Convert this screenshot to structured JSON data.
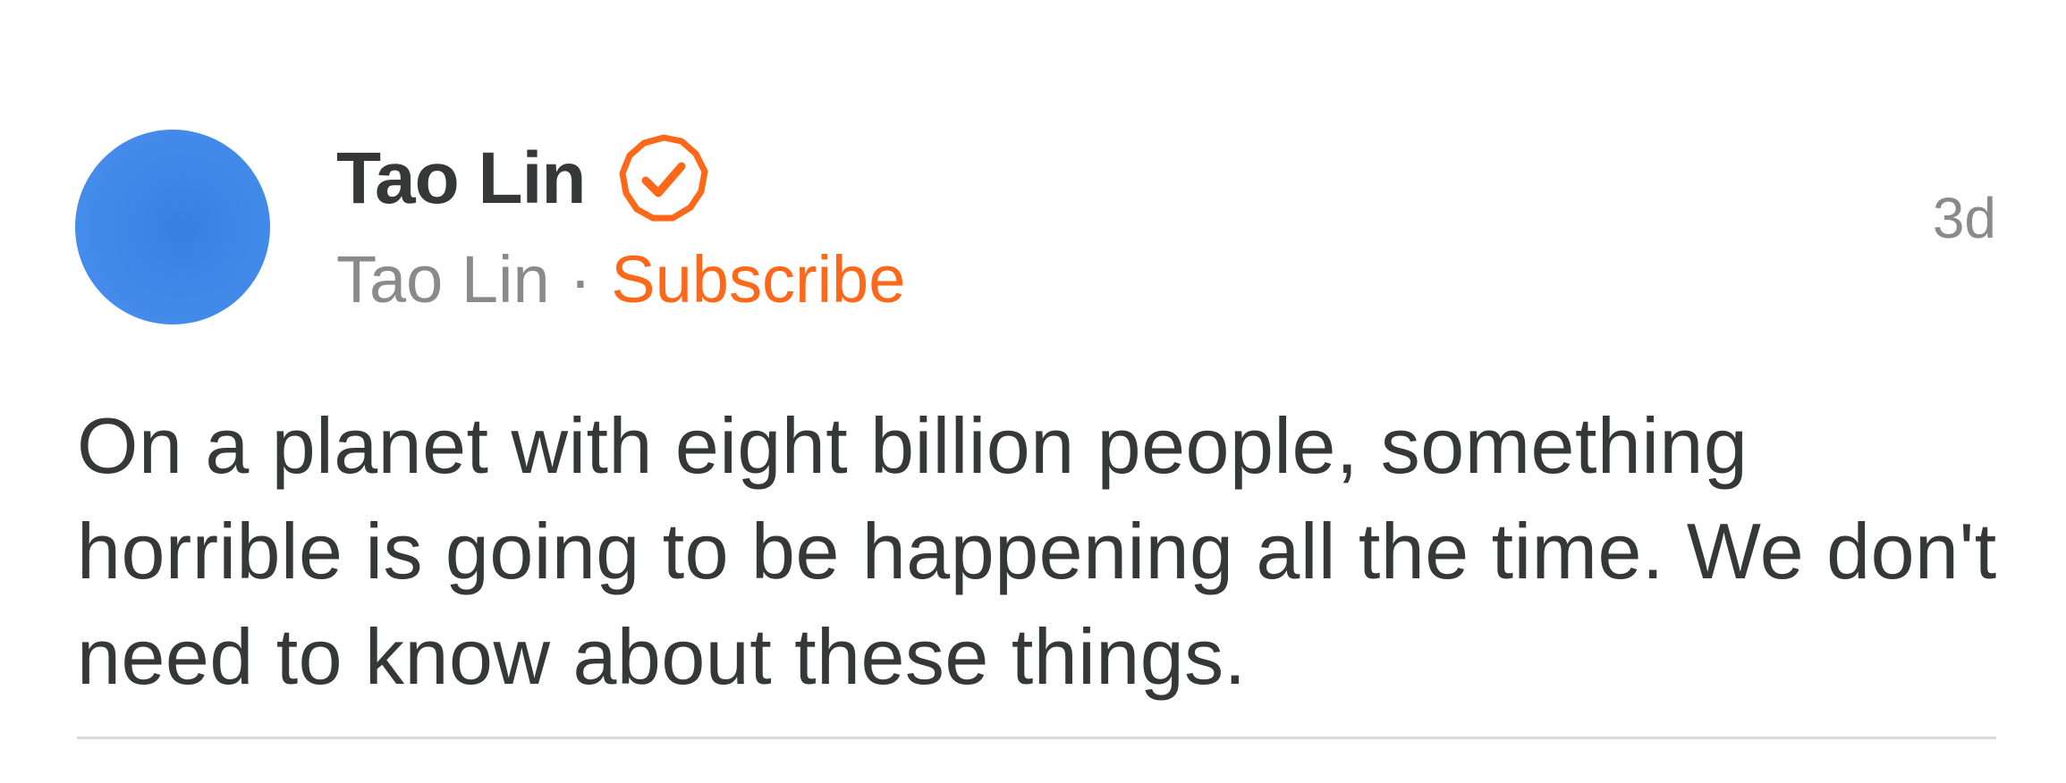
{
  "post": {
    "author_name": "Tao Lin",
    "publication_name": "Tao Lin",
    "separator": "·",
    "subscribe_label": "Subscribe",
    "timestamp": "3d",
    "body": "On a planet with eight billion people, something horrible is going to be happening all the time. We don't need to know about these things.",
    "verified_icon": "verified-badge-icon",
    "accent_color": "#ff6719",
    "avatar_color": "#3f88e8"
  }
}
